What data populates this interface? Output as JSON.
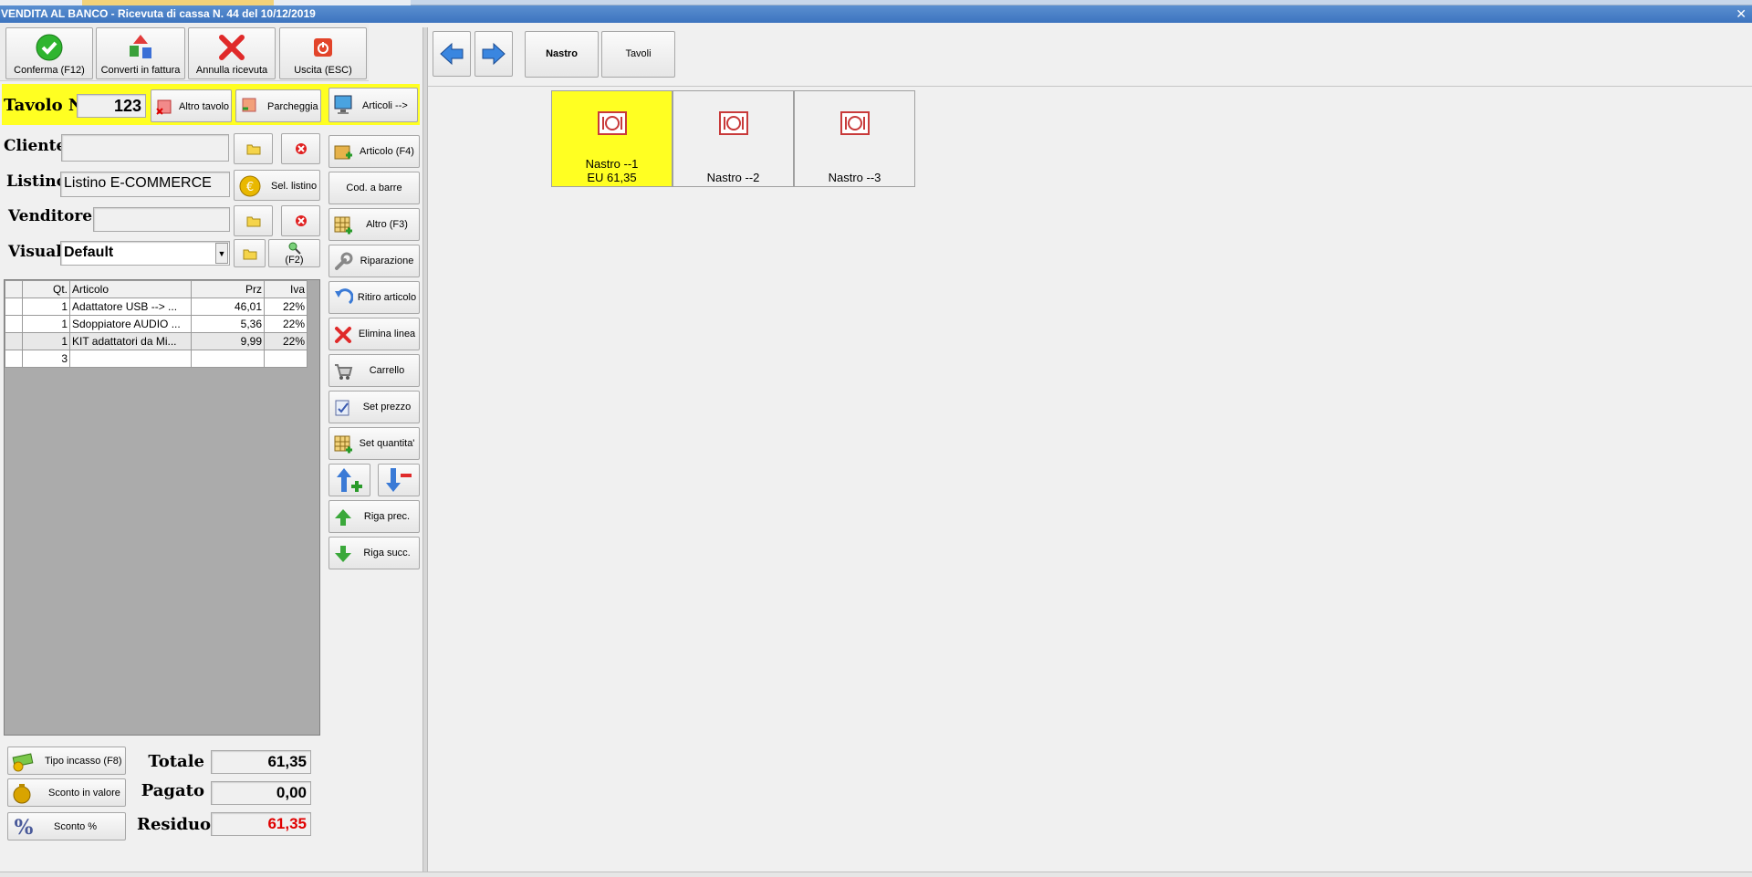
{
  "window": {
    "title": "VENDITA AL BANCO - Ricevuta di cassa N. 44 del 10/12/2019",
    "close_label": "✕"
  },
  "toolbar": {
    "confirm": "Conferma (F12)",
    "convert": "Converti in fattura",
    "cancel": "Annulla ricevuta",
    "exit": "Uscita (ESC)"
  },
  "table_bar": {
    "label": "Tavolo N.",
    "number": "123",
    "other_table": "Altro tavolo",
    "park": "Parcheggia",
    "articles": "Articoli -->"
  },
  "form": {
    "client_label": "Cliente",
    "client_value": "",
    "list_label": "Listino",
    "list_value": "Listino E-COMMERCE",
    "sel_list": "Sel. listino",
    "seller_label": "Venditore",
    "seller_value": "",
    "visual_label": "Visual.",
    "visual_value": "Default",
    "f2_label": "(F2)"
  },
  "grid": {
    "headers": [
      "Qt.",
      "Articolo",
      "Prz",
      "Iva"
    ],
    "rows": [
      {
        "qt": "1",
        "articolo": "Adattatore USB --> ...",
        "prz": "46,01",
        "iva": "22%"
      },
      {
        "qt": "1",
        "articolo": "Sdoppiatore AUDIO ...",
        "prz": "5,36",
        "iva": "22%"
      },
      {
        "qt": "1",
        "articolo": "KIT adattatori da Mi...",
        "prz": "9,99",
        "iva": "22%"
      },
      {
        "qt": "3",
        "articolo": "",
        "prz": "",
        "iva": ""
      }
    ]
  },
  "side_buttons": {
    "article": "Articolo (F4)",
    "barcode": "Cod. a barre",
    "other": "Altro (F3)",
    "repair": "Riparazione",
    "withdraw": "Ritiro articolo",
    "delete_line": "Elimina linea",
    "cart": "Carrello",
    "set_price": "Set prezzo",
    "set_qty": "Set quantita'",
    "prev_row": "Riga prec.",
    "next_row": "Riga succ."
  },
  "payment": {
    "payment_type": "Tipo incasso (F8)",
    "discount_value": "Sconto in valore",
    "discount_pct": "Sconto %"
  },
  "totals": {
    "total_label": "Totale",
    "total_value": "61,35",
    "paid_label": "Pagato",
    "paid_value": "0,00",
    "rest_label": "Residuo",
    "rest_value": "61,35",
    "rest_color": "#e00000"
  },
  "right": {
    "tab_nastro": "Nastro",
    "tab_tavoli": "Tavoli",
    "tiles": [
      {
        "name": "Nastro --1",
        "amount": "EU 61,35",
        "active": true
      },
      {
        "name": "Nastro --2",
        "amount": "",
        "active": false
      },
      {
        "name": "Nastro --3",
        "amount": "",
        "active": false
      }
    ],
    "active_color": "#ffff22"
  }
}
